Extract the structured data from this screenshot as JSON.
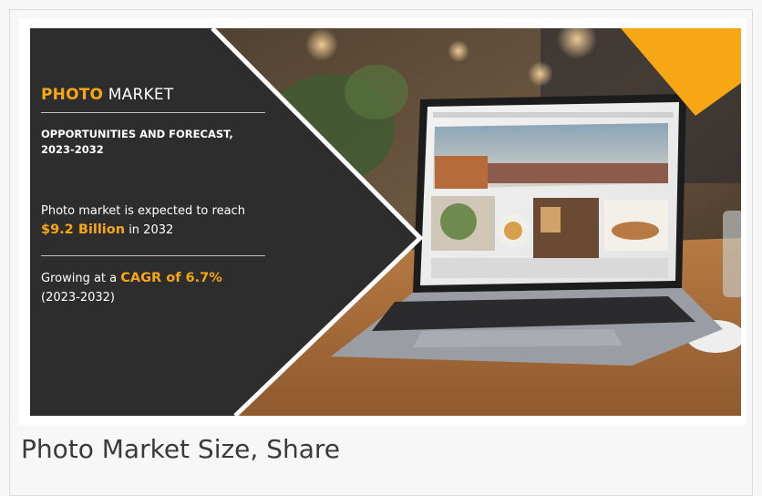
{
  "banner": {
    "title_accent": "PHOTO",
    "title_rest": "MARKET",
    "subtitle": "OPPORTUNITIES AND FORECAST, 2023-2032",
    "reach_text": "Photo market is expected to reach",
    "reach_value": "$9.2 Billion",
    "reach_year": "in 2032",
    "cagr_prefix": "Growing at a",
    "cagr_value": "CAGR of 6.7%",
    "cagr_period": "(2023-2032)"
  },
  "caption": "Photo Market Size, Share",
  "colors": {
    "panel": "#2d2d2d",
    "accent": "#f7a614",
    "caption": "#3a3a3a"
  }
}
